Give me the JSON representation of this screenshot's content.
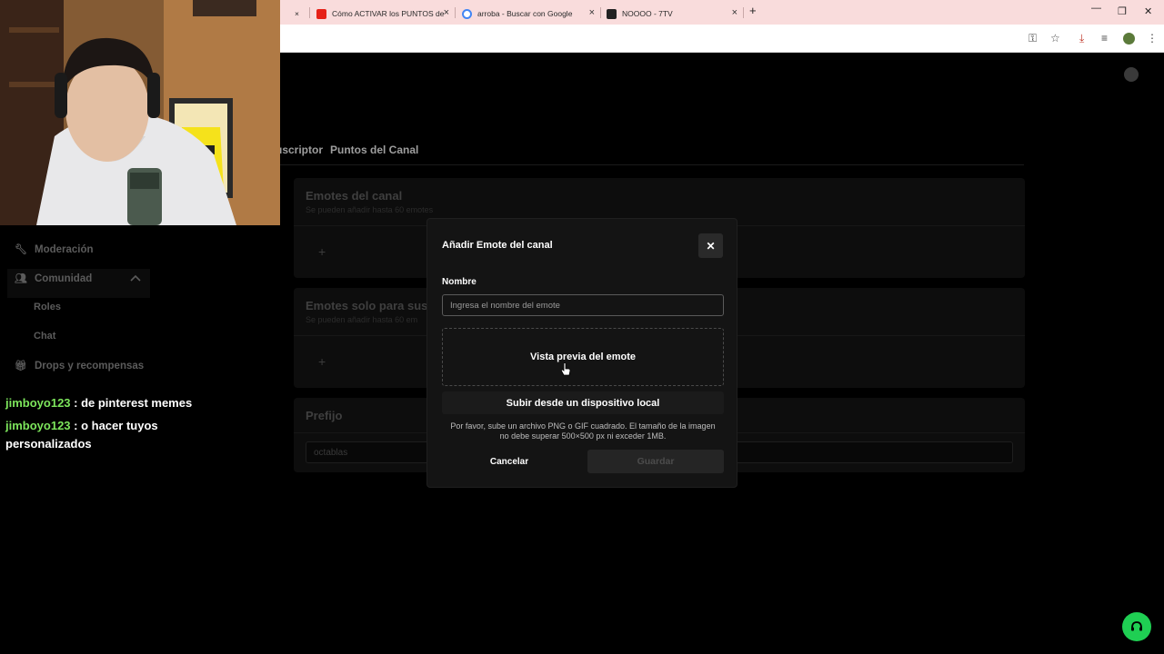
{
  "browser": {
    "tabs": [
      {
        "label": "Cómo ACTIVAR los PUNTOS de",
        "favicon": "youtube-icon",
        "color": "#e62117"
      },
      {
        "label": "arroba - Buscar con Google",
        "favicon": "google-icon",
        "color": "#4285f4"
      },
      {
        "label": "NOOOO - 7TV",
        "favicon": "7tv-icon",
        "color": "#222222"
      }
    ],
    "new_tab": "+",
    "close_glyph": "×"
  },
  "page": {
    "nav_tabs": [
      "uscriptor",
      "Puntos del Canal"
    ],
    "sections": {
      "channel_emotes": {
        "title": "Emotes del canal",
        "subtitle": "Se pueden añadir hasta 60 emotes"
      },
      "sub_emotes": {
        "title": "Emotes solo para susc",
        "subtitle": "Se pueden añadir hasta 60 em"
      },
      "prefix": {
        "title": "Prefijo",
        "value": "octablas"
      }
    },
    "add_glyph": "+"
  },
  "sidebar": {
    "items": [
      {
        "label": "Moderación",
        "icon": "wrench-icon"
      },
      {
        "label": "Comunidad",
        "icon": "users-icon"
      },
      {
        "label": "Drops y recompensas",
        "icon": "gift-icon"
      }
    ],
    "sub_items": [
      "Roles",
      "Chat"
    ]
  },
  "chat": [
    {
      "user": "jimboyo123",
      "message": " : de pinterest memes"
    },
    {
      "user": "jimboyo123",
      "message": " : o hacer tuyos personalizados"
    }
  ],
  "modal": {
    "title": "Añadir Emote del canal",
    "name_label": "Nombre",
    "name_placeholder": "Ingresa el nombre del emote",
    "preview_label": "Vista previa del emote",
    "upload_label": "Subir desde un dispositivo local",
    "hint": "Por favor, sube un archivo PNG o GIF cuadrado. El tamaño de la imagen no debe superar 500×500 px ni exceder 1MB.",
    "cancel_label": "Cancelar",
    "save_label": "Guardar"
  },
  "colors": {
    "accent": "#1fcf53",
    "chat_user": "#7de65c"
  }
}
